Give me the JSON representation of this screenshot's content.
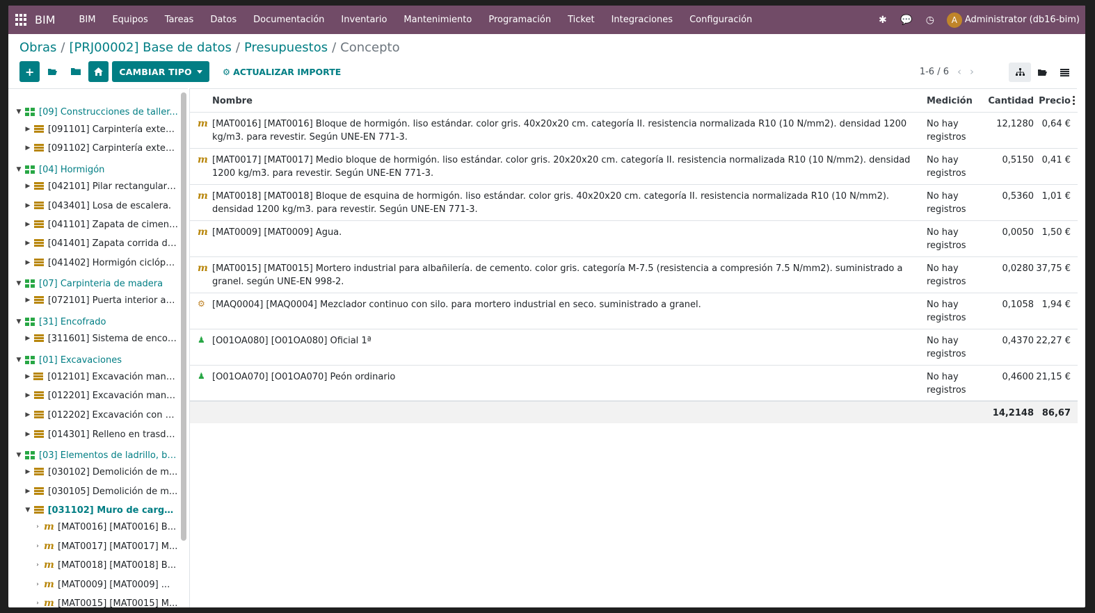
{
  "navbar": {
    "brand": "BIM",
    "menu": [
      "BIM",
      "Equipos",
      "Tareas",
      "Datos",
      "Documentación",
      "Inventario",
      "Mantenimiento",
      "Programación",
      "Ticket",
      "Integraciones",
      "Configuración"
    ],
    "user_initial": "A",
    "user_name": "Administrator (db16-bim)",
    "accent": "#714b67"
  },
  "breadcrumb": {
    "items": [
      "Obras",
      "[PRJ00002] Base de datos",
      "Presupuestos"
    ],
    "current": "Concepto"
  },
  "toolbar": {
    "change_type_label": "CAMBIAR TIPO",
    "update_amount_label": "ACTUALIZAR IMPORTE",
    "primary_color": "#017e84"
  },
  "pager": {
    "text": "1-6 / 6"
  },
  "tree": [
    {
      "level": 0,
      "type": "chapter",
      "label": "[09] Construcciones de taller..."
    },
    {
      "level": 1,
      "type": "item",
      "label": "[091101] Carpintería exteri..."
    },
    {
      "level": 1,
      "type": "item",
      "label": "[091102] Carpintería exteri..."
    },
    {
      "level": 0,
      "type": "chapter",
      "label": "[04] Hormigón"
    },
    {
      "level": 1,
      "type": "item",
      "label": "[042101] Pilar rectangular ..."
    },
    {
      "level": 1,
      "type": "item",
      "label": "[043401] Losa de escalera."
    },
    {
      "level": 1,
      "type": "item",
      "label": "[041101] Zapata de ciment..."
    },
    {
      "level": 1,
      "type": "item",
      "label": "[041401] Zapata corrida de..."
    },
    {
      "level": 1,
      "type": "item",
      "label": "[041402] Hormigón ciclópe..."
    },
    {
      "level": 0,
      "type": "chapter",
      "label": "[07] Carpinteria de madera"
    },
    {
      "level": 1,
      "type": "item",
      "label": "[072101] Puerta interior ab..."
    },
    {
      "level": 0,
      "type": "chapter",
      "label": "[31] Encofrado"
    },
    {
      "level": 1,
      "type": "item",
      "label": "[311601] Sistema de encofr..."
    },
    {
      "level": 0,
      "type": "chapter",
      "label": "[01] Excavaciones"
    },
    {
      "level": 1,
      "type": "item",
      "label": "[012101] Excavación manua..."
    },
    {
      "level": 1,
      "type": "item",
      "label": "[012201] Excavación manu..."
    },
    {
      "level": 1,
      "type": "item",
      "label": "[012202] Excavación con m..."
    },
    {
      "level": 1,
      "type": "item",
      "label": "[014301] Relleno en trasdó..."
    },
    {
      "level": 0,
      "type": "chapter",
      "label": "[03] Elementos de ladrillo, bl..."
    },
    {
      "level": 1,
      "type": "item",
      "label": "[030102] Demolición de m..."
    },
    {
      "level": 1,
      "type": "item",
      "label": "[030105] Demolición de m..."
    },
    {
      "level": 1,
      "type": "selected",
      "label": "[031102] Muro de carga ..."
    },
    {
      "level": 2,
      "type": "material",
      "label": "[MAT0016] [MAT0016] B..."
    },
    {
      "level": 2,
      "type": "material",
      "label": "[MAT0017] [MAT0017] M..."
    },
    {
      "level": 2,
      "type": "material",
      "label": "[MAT0018] [MAT0018] B..."
    },
    {
      "level": 2,
      "type": "material",
      "label": "[MAT0009] [MAT0009] ..."
    },
    {
      "level": 2,
      "type": "material",
      "label": "[MAT0015] [MAT0015] M..."
    }
  ],
  "table": {
    "headers": {
      "name": "Nombre",
      "measure": "Medición",
      "qty": "Cantidad",
      "price": "Precio"
    },
    "rows": [
      {
        "icon": "m",
        "name": "[MAT0016] [MAT0016] Bloque de hormigón. liso estándar. color gris. 40x20x20 cm. categoría II. resistencia normalizada R10 (10 N/mm2). densidad 1200 kg/m3. para revestir. Según UNE-EN 771-3.",
        "measure": "No hay registros",
        "qty": "12,1280",
        "price": "0,64 €"
      },
      {
        "icon": "m",
        "name": "[MAT0017] [MAT0017] Medio bloque de hormigón. liso estándar. color gris. 20x20x20 cm. categoría II. resistencia normalizada R10 (10 N/mm2). densidad 1200 kg/m3. para revestir. Según UNE-EN 771-3.",
        "measure": "No hay registros",
        "qty": "0,5150",
        "price": "0,41 €"
      },
      {
        "icon": "m",
        "name": "[MAT0018] [MAT0018] Bloque de esquina de hormigón. liso estándar. color gris. 40x20x20 cm. categoría II. resistencia normalizada R10 (10 N/mm2). densidad 1200 kg/m3. para revestir. Según UNE-EN 771-3.",
        "measure": "No hay registros",
        "qty": "0,5360",
        "price": "1,01 €"
      },
      {
        "icon": "m",
        "name": "[MAT0009] [MAT0009] Agua.",
        "measure": "No hay registros",
        "qty": "0,0050",
        "price": "1,50 €"
      },
      {
        "icon": "m",
        "name": "[MAT0015] [MAT0015] Mortero industrial para albañilería. de cemento. color gris. categoría M-7.5 (resistencia a compresión 7.5 N/mm2). suministrado a granel. según UNE-EN 998-2.",
        "measure": "No hay registros",
        "qty": "0,0280",
        "price": "37,75 €"
      },
      {
        "icon": "gear",
        "name": "[MAQ0004] [MAQ0004] Mezclador continuo con silo. para mortero industrial en seco. suministrado a granel.",
        "measure": "No hay registros",
        "qty": "0,1058",
        "price": "1,94 €"
      },
      {
        "icon": "person",
        "name": "[O01OA080] [O01OA080] Oficial 1ª",
        "measure": "No hay registros",
        "qty": "0,4370",
        "price": "22,27 €"
      },
      {
        "icon": "person",
        "name": "[O01OA070] [O01OA070] Peón ordinario",
        "measure": "No hay registros",
        "qty": "0,4600",
        "price": "21,15 €"
      }
    ],
    "totals": {
      "qty": "14,2148",
      "price": "86,67"
    }
  }
}
